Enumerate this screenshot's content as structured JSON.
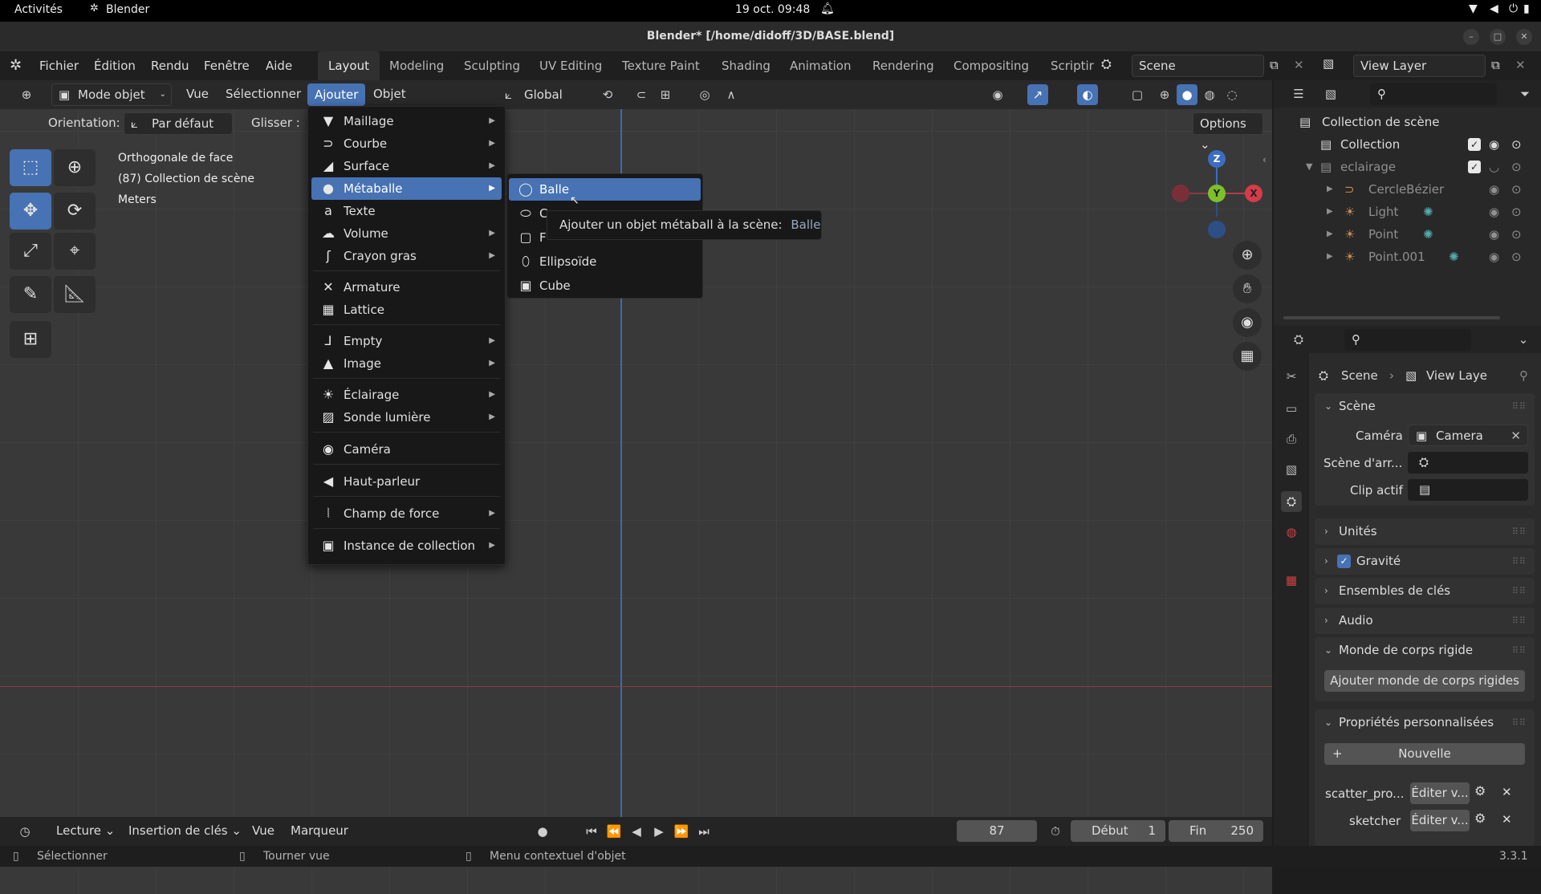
{
  "gnome": {
    "activities": "Activités",
    "app": "Blender",
    "clock": "19 oct.  09:48"
  },
  "window": {
    "title": "Blender* [/home/didoff/3D/BASE.blend]"
  },
  "menubar": {
    "file": "Fichier",
    "edit": "Édition",
    "render": "Rendu",
    "window": "Fenêtre",
    "help": "Aide"
  },
  "workspaces": [
    "Layout",
    "Modeling",
    "Sculpting",
    "UV Editing",
    "Texture Paint",
    "Shading",
    "Animation",
    "Rendering",
    "Compositing",
    "Scriptir"
  ],
  "scene_field": "Scene",
  "viewlayer_field": "View Layer",
  "viewport_header": {
    "mode": "Mode objet",
    "view": "Vue",
    "select": "Sélectionner",
    "add": "Ajouter",
    "object": "Objet",
    "transform": "Global"
  },
  "tool_settings": {
    "orientation_label": "Orientation:",
    "orientation_value": "Par défaut",
    "drag_label": "Glisser :",
    "options": "Options"
  },
  "overlay_text": {
    "line1": "Orthogonale de face",
    "line2": "(87) Collection de scène",
    "line3": "Meters"
  },
  "add_menu": {
    "items": [
      {
        "label": "Maillage",
        "icon": "▼"
      },
      {
        "label": "Courbe",
        "icon": "⊃"
      },
      {
        "label": "Surface",
        "icon": "◢"
      },
      {
        "label": "Métaballe",
        "icon": "●"
      },
      {
        "label": "Texte",
        "icon": "a"
      },
      {
        "label": "Volume",
        "icon": "☁"
      },
      {
        "label": "Crayon gras",
        "icon": "ʃ"
      },
      {
        "label": "Armature",
        "icon": "✕"
      },
      {
        "label": "Lattice",
        "icon": "▦"
      },
      {
        "label": "Empty",
        "icon": "⅃"
      },
      {
        "label": "Image",
        "icon": "▲"
      },
      {
        "label": "Éclairage",
        "icon": "☀"
      },
      {
        "label": "Sonde lumière",
        "icon": "▨"
      },
      {
        "label": "Caméra",
        "icon": "◉"
      },
      {
        "label": "Haut-parleur",
        "icon": "◀"
      },
      {
        "label": "Champ de force",
        "icon": "⦚"
      },
      {
        "label": "Instance de collection",
        "icon": "▣"
      }
    ]
  },
  "metaball_submenu": {
    "items": [
      "Balle",
      "C",
      "F",
      "Ellipsoïde",
      "Cube"
    ]
  },
  "tooltip": {
    "text": "Ajouter un objet métaball à la scène:",
    "value": "Balle"
  },
  "gizmo": {
    "z": "Z",
    "y": "Y",
    "x": "X"
  },
  "outliner": {
    "root": "Collection de scène",
    "collection": "Collection",
    "eclairage": "eclairage",
    "children": [
      "CercleBézier",
      "Light",
      "Point",
      "Point.001"
    ]
  },
  "properties": {
    "breadcrumb_scene": "Scene",
    "breadcrumb_layer": "View Laye",
    "scene_panel": "Scène",
    "camera_label": "Caméra",
    "camera_value": "Camera",
    "bg_scene_label": "Scène d'arr...",
    "clip_label": "Clip actif",
    "units": "Unités",
    "gravity": "Gravité",
    "keying_sets": "Ensembles de clés",
    "audio": "Audio",
    "rigidbody": "Monde de corps rigide",
    "rigidbody_btn": "Ajouter monde de corps rigides",
    "custom_props": "Propriétés personnalisées",
    "new_btn": "Nouvelle",
    "prop1_name": "scatter_pro...",
    "prop1_btn": "Éditer v...",
    "prop2_name": "sketcher",
    "prop2_btn": "Éditer v..."
  },
  "timeline": {
    "playback": "Lecture",
    "keying": "Insertion de clés",
    "view": "Vue",
    "marker": "Marqueur",
    "frame": "87",
    "start_label": "Début",
    "start": "1",
    "end_label": "Fin",
    "end": "250"
  },
  "statusbar": {
    "select": "Sélectionner",
    "rotate": "Tourner vue",
    "context": "Menu contextuel d'objet",
    "version": "3.3.1"
  }
}
